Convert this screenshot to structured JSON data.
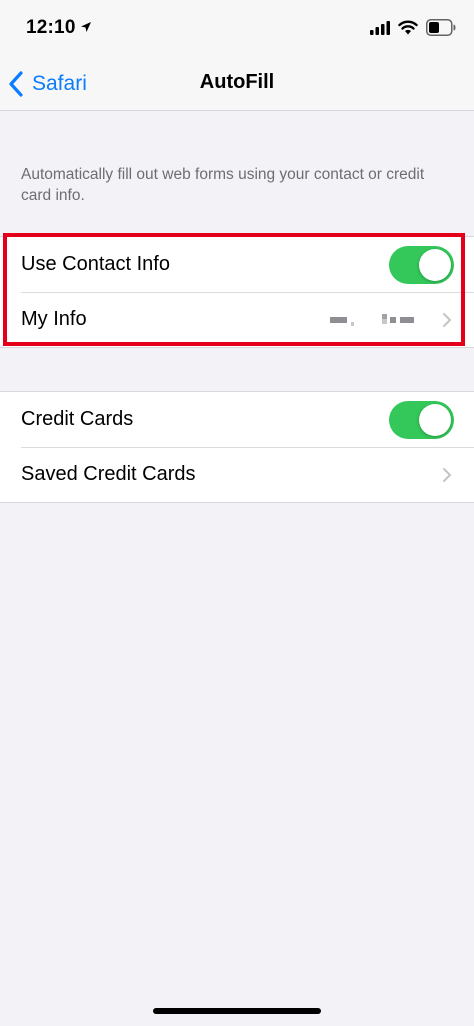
{
  "status_bar": {
    "time": "12:10"
  },
  "nav": {
    "back_label": "Safari",
    "title": "AutoFill"
  },
  "description": "Automatically fill out web forms using your contact or credit card info.",
  "group1": {
    "use_contact_info": {
      "label": "Use Contact Info",
      "on": true
    },
    "my_info": {
      "label": "My Info"
    }
  },
  "group2": {
    "credit_cards": {
      "label": "Credit Cards",
      "on": true
    },
    "saved_credit_cards": {
      "label": "Saved Credit Cards"
    }
  },
  "colors": {
    "accent": "#0a7cff",
    "toggle_on": "#34c759",
    "highlight": "#e4001b",
    "background": "#f2f2f7"
  },
  "icons": [
    "location-arrow-icon",
    "cellular-signal-icon",
    "wifi-icon",
    "battery-icon",
    "back-chevron-icon",
    "chevron-right-icon"
  ]
}
